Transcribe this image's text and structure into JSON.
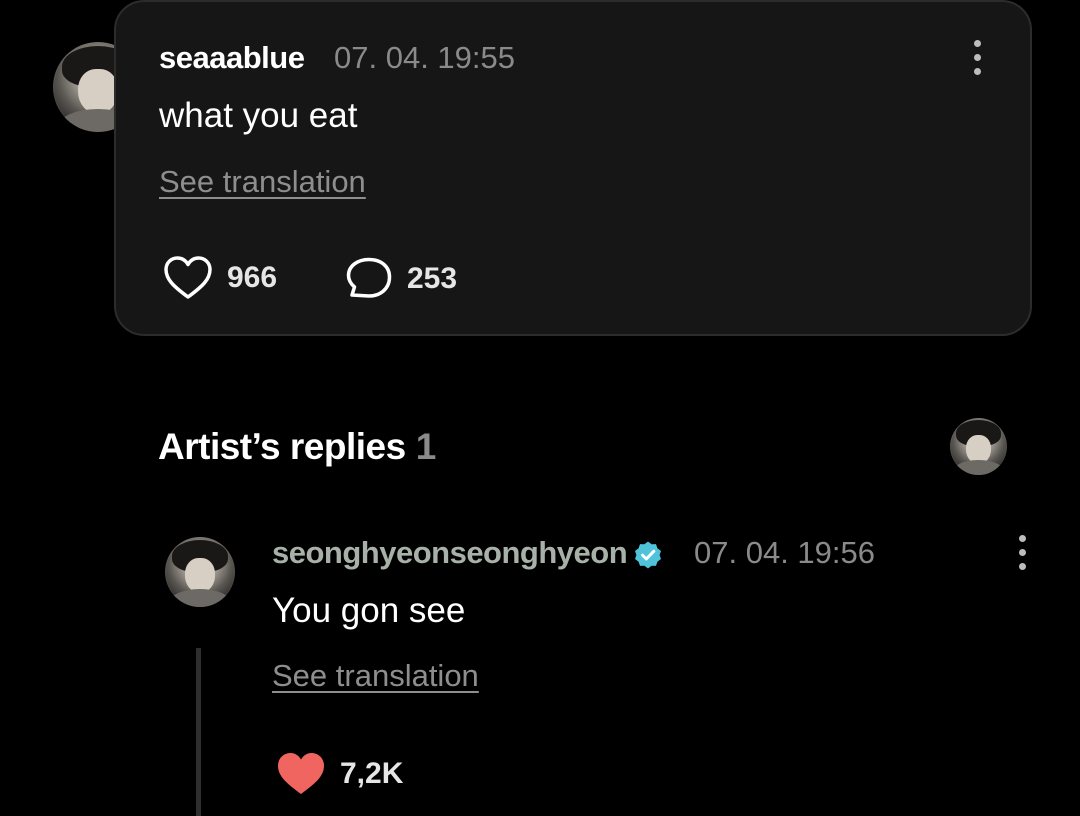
{
  "comment": {
    "username": "seaaablue",
    "timestamp": "07. 04. 19:55",
    "text": "what you eat",
    "translate_label": "See translation",
    "likes": "966",
    "replies": "253"
  },
  "artist_replies": {
    "title": "Artist’s replies",
    "count": "1"
  },
  "reply": {
    "username": "seonghyeonseonghyeon",
    "verified": true,
    "timestamp": "07. 04. 19:56",
    "text": "You gon see",
    "translate_label": "See translation",
    "likes": "7,2K"
  },
  "colors": {
    "background": "#000000",
    "card": "#161616",
    "muted_text": "#8a8a8a",
    "liked_heart": "#f06560",
    "verified_badge": "#4fc3d9"
  }
}
